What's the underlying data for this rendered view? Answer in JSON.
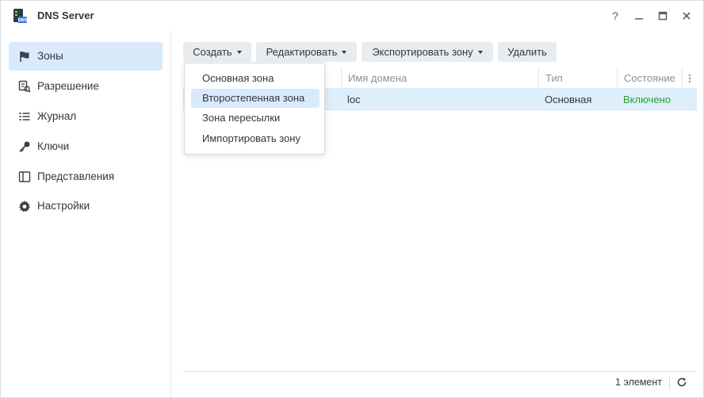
{
  "window": {
    "title": "DNS Server",
    "controls": {
      "help": "?",
      "minimize": "—",
      "maximize": "☐",
      "close": "✕"
    }
  },
  "sidebar": {
    "items": [
      {
        "label": "Зоны",
        "icon": "flag-icon",
        "active": true
      },
      {
        "label": "Разрешение",
        "icon": "resolution-icon",
        "active": false
      },
      {
        "label": "Журнал",
        "icon": "list-icon",
        "active": false
      },
      {
        "label": "Ключи",
        "icon": "key-icon",
        "active": false
      },
      {
        "label": "Представления",
        "icon": "views-icon",
        "active": false
      },
      {
        "label": "Настройки",
        "icon": "gear-icon",
        "active": false
      }
    ]
  },
  "toolbar": {
    "create_label": "Создать",
    "edit_label": "Редактировать",
    "export_label": "Экспортировать зону",
    "delete_label": "Удалить"
  },
  "dropdown": {
    "items": [
      "Основная зона",
      "Второстепенная зона",
      "Зона пересылки",
      "Импортировать зону"
    ]
  },
  "grid": {
    "columns": [
      "Имя домена",
      "Тип",
      "Состояние"
    ],
    "rows": [
      {
        "domain": "loc",
        "type": "Основная",
        "status": "Включено"
      }
    ]
  },
  "footer": {
    "count_text": "1 элемент"
  },
  "colors": {
    "accent": "#d9eafb",
    "enabled": "#28a228",
    "row_selected": "#ddeefc"
  }
}
